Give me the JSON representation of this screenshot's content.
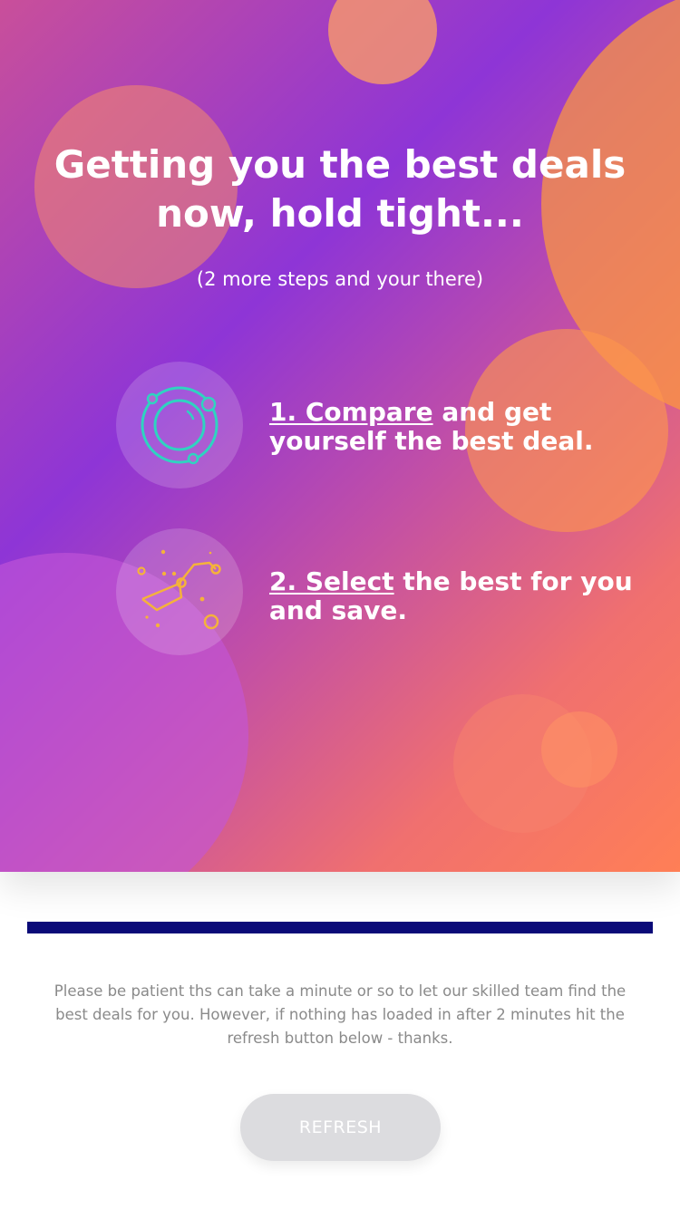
{
  "hero": {
    "title_line1": "Getting you the best deals",
    "title_line2": "now, hold tight...",
    "subtitle": "(2 more steps and your there)"
  },
  "steps": [
    {
      "icon": "planet-orbit-icon",
      "link": "1. Compare",
      "rest_line1": " and get",
      "rest_line2": "yourself the best deal."
    },
    {
      "icon": "constellation-icon",
      "link": "2. Select",
      "rest_line1": " the best for you",
      "rest_line2": "and save."
    }
  ],
  "progress": {
    "value": 1.0
  },
  "notice": "Please be patient ths can take a minute or so to let our skilled team find the best deals for you. However, if nothing has loaded in after 2 minutes hit the refresh button below - thanks.",
  "refresh_button": {
    "label": "REFRESH",
    "state": "disabled"
  },
  "colors": {
    "progress_fill": "#0a0a78",
    "icon_teal": "#2fd3c0",
    "icon_gold": "#f5b23a",
    "button_bg": "#dcdcdf"
  }
}
